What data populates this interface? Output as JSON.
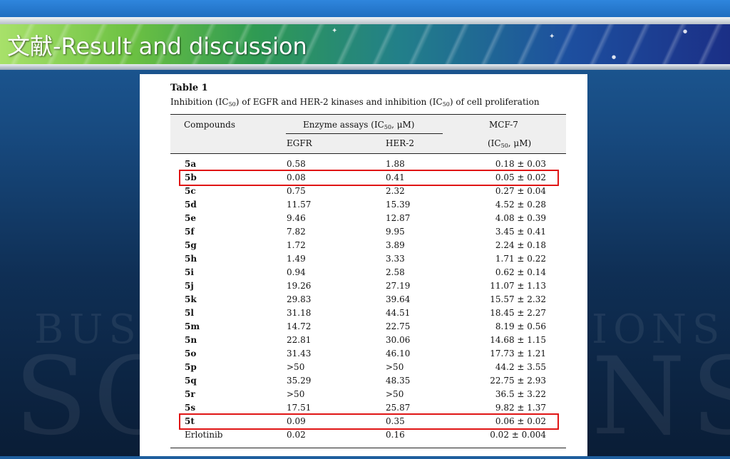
{
  "slide": {
    "title": "文献-Result and discussion",
    "background_words": [
      "BUS",
      "IONS",
      "SO",
      "NS"
    ]
  },
  "table": {
    "label": "Table 1",
    "caption": {
      "part1": "Inhibition (IC",
      "sub1": "50",
      "part2": ") of EGFR and HER-2 kinases and inhibition (IC",
      "sub2": "50",
      "part3": ") of cell proliferation"
    },
    "headers": {
      "compounds": "Compounds",
      "enzyme_pre": "Enzyme assays (IC",
      "enzyme_sub": "50",
      "enzyme_post": ", μM)",
      "egfr": "EGFR",
      "her2": "HER-2",
      "mcf7": "MCF-7",
      "mcf7_unit_pre": "(IC",
      "mcf7_unit_sub": "50",
      "mcf7_unit_post": ", μM)"
    },
    "rows": [
      {
        "compound": "5a",
        "egfr": "0.58",
        "her2": "1.88",
        "mcf7": "0.18 ± 0.03"
      },
      {
        "compound": "5b",
        "egfr": "0.08",
        "her2": "0.41",
        "mcf7": "0.05 ± 0.02"
      },
      {
        "compound": "5c",
        "egfr": "0.75",
        "her2": "2.32",
        "mcf7": "0.27 ± 0.04"
      },
      {
        "compound": "5d",
        "egfr": "11.57",
        "her2": "15.39",
        "mcf7": "4.52 ± 0.28"
      },
      {
        "compound": "5e",
        "egfr": "9.46",
        "her2": "12.87",
        "mcf7": "4.08 ± 0.39"
      },
      {
        "compound": "5f",
        "egfr": "7.82",
        "her2": "9.95",
        "mcf7": "3.45 ± 0.41"
      },
      {
        "compound": "5g",
        "egfr": "1.72",
        "her2": "3.89",
        "mcf7": "2.24 ± 0.18"
      },
      {
        "compound": "5h",
        "egfr": "1.49",
        "her2": "3.33",
        "mcf7": "1.71 ± 0.22"
      },
      {
        "compound": "5i",
        "egfr": "0.94",
        "her2": "2.58",
        "mcf7": "0.62 ± 0.14"
      },
      {
        "compound": "5j",
        "egfr": "19.26",
        "her2": "27.19",
        "mcf7": "11.07 ± 1.13"
      },
      {
        "compound": "5k",
        "egfr": "29.83",
        "her2": "39.64",
        "mcf7": "15.57 ± 2.32"
      },
      {
        "compound": "5l",
        "egfr": "31.18",
        "her2": "44.51",
        "mcf7": "18.45 ± 2.27"
      },
      {
        "compound": "5m",
        "egfr": "14.72",
        "her2": "22.75",
        "mcf7": "8.19 ± 0.56"
      },
      {
        "compound": "5n",
        "egfr": "22.81",
        "her2": "30.06",
        "mcf7": "14.68 ± 1.15"
      },
      {
        "compound": "5o",
        "egfr": "31.43",
        "her2": "46.10",
        "mcf7": "17.73 ± 1.21"
      },
      {
        "compound": "5p",
        "egfr": ">50",
        "her2": ">50",
        "mcf7": "44.2 ± 3.55"
      },
      {
        "compound": "5q",
        "egfr": "35.29",
        "her2": "48.35",
        "mcf7": "22.75 ± 2.93"
      },
      {
        "compound": "5r",
        "egfr": ">50",
        "her2": ">50",
        "mcf7": "36.5 ± 3.22"
      },
      {
        "compound": "5s",
        "egfr": "17.51",
        "her2": "25.87",
        "mcf7": "9.82 ± 1.37"
      },
      {
        "compound": "5t",
        "egfr": "0.09",
        "her2": "0.35",
        "mcf7": "0.06 ± 0.02"
      },
      {
        "compound": "Erlotinib",
        "egfr": "0.02",
        "her2": "0.16",
        "mcf7": "0.02 ± 0.004"
      }
    ],
    "highlighted_compounds": [
      "5b",
      "5t"
    ],
    "highlight_color": "#e01515"
  }
}
